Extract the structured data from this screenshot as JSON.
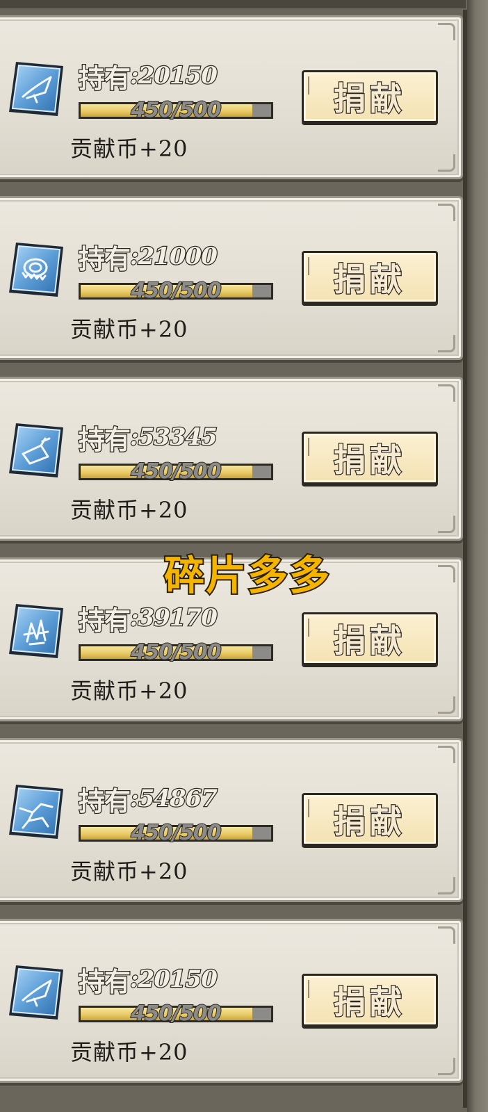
{
  "overlay_text": "碎片多多",
  "rows": [
    {
      "icon": "paper-crane-shard-icon",
      "count_label": "持有",
      "count_value": ":20150",
      "progress_text": "450/500",
      "progress_fraction": 0.9,
      "reward": "贡献币+20",
      "button_label": "捐献"
    },
    {
      "icon": "gear-disc-shard-icon",
      "count_label": "持有",
      "count_value": ":21000",
      "progress_text": "450/500",
      "progress_fraction": 0.9,
      "reward": "贡献币+20",
      "button_label": "捐献"
    },
    {
      "icon": "paper-fold-shard-icon",
      "count_label": "持有",
      "count_value": ":53345",
      "progress_text": "450/500",
      "progress_fraction": 0.9,
      "reward": "贡献币+20",
      "button_label": "捐献"
    },
    {
      "icon": "crystal-cluster-shard-icon",
      "count_label": "持有",
      "count_value": ":39170",
      "progress_text": "450/500",
      "progress_fraction": 0.9,
      "reward": "贡献币+20",
      "button_label": "捐献"
    },
    {
      "icon": "cracked-ice-shard-icon",
      "count_label": "持有",
      "count_value": ":54867",
      "progress_text": "450/500",
      "progress_fraction": 0.9,
      "reward": "贡献币+20",
      "button_label": "捐献"
    },
    {
      "icon": "paper-crane-shard-icon",
      "count_label": "持有",
      "count_value": ":20150",
      "progress_text": "450/500",
      "progress_fraction": 0.9,
      "reward": "贡献币+20",
      "button_label": "捐献"
    }
  ],
  "colors": {
    "icon_blue": "#5f9fd8",
    "progress_gold": "#e7c862",
    "overlay_yellow": "#f5b400",
    "panel_bg": "#e3dfd4"
  }
}
